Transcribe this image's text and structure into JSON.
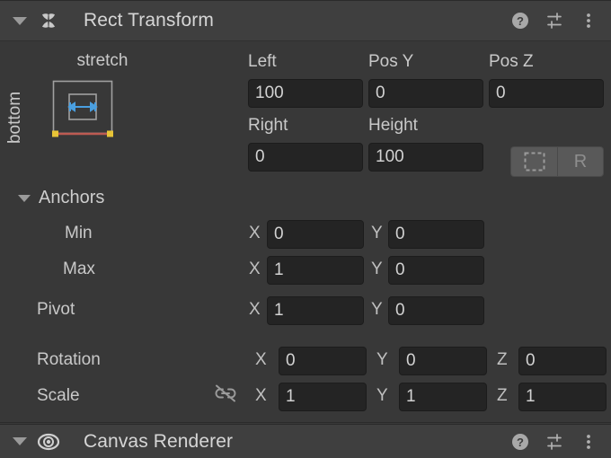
{
  "components": [
    {
      "title": "Rect Transform",
      "icon": "rect-transform-icon",
      "expanded": true,
      "actions": [
        {
          "name": "help-icon",
          "label": "?"
        },
        {
          "name": "preset-icon",
          "label": ""
        },
        {
          "name": "more-menu-icon",
          "label": ""
        }
      ]
    },
    {
      "title": "Canvas Renderer",
      "icon": "canvas-renderer-eye-icon",
      "expanded": true,
      "actions": [
        {
          "name": "help-icon",
          "label": "?"
        },
        {
          "name": "preset-icon",
          "label": ""
        },
        {
          "name": "more-menu-icon",
          "label": ""
        }
      ]
    }
  ],
  "anchor_preset": {
    "horizontal_label": "stretch",
    "vertical_label": "bottom",
    "outer_color": "#a0a0a0",
    "inner_color": "#a0a0a0",
    "arrow_color": "#4a9fe0",
    "anchor_line_color": "#bd5b52",
    "handle_color": "#e8c437"
  },
  "rect_fields": {
    "left": {
      "label": "Left",
      "value": "100"
    },
    "pos_y": {
      "label": "Pos Y",
      "value": "0"
    },
    "pos_z": {
      "label": "Pos Z",
      "value": "0"
    },
    "right": {
      "label": "Right",
      "value": "0"
    },
    "height": {
      "label": "Height",
      "value": "100"
    }
  },
  "mode_toggles": {
    "blueprint": {
      "label": "",
      "name": "blueprint-mode-toggle",
      "active": false
    },
    "raw": {
      "label": "R",
      "name": "raw-mode-toggle",
      "active": false
    }
  },
  "anchors": {
    "section_label": "Anchors",
    "rows": [
      {
        "label": "Min",
        "x_label": "X",
        "x": "0",
        "y_label": "Y",
        "y": "0"
      },
      {
        "label": "Max",
        "x_label": "X",
        "x": "1",
        "y_label": "Y",
        "y": "0"
      }
    ]
  },
  "pivot": {
    "label": "Pivot",
    "x_label": "X",
    "x": "1",
    "y_label": "Y",
    "y": "0"
  },
  "rotation": {
    "label": "Rotation",
    "x_label": "X",
    "x": "0",
    "y_label": "Y",
    "y": "0",
    "z_label": "Z",
    "z": "0"
  },
  "scale": {
    "label": "Scale",
    "link_icon": "link-off-icon",
    "x_label": "X",
    "x": "1",
    "y_label": "Y",
    "y": "1",
    "z_label": "Z",
    "z": "1"
  },
  "colors": {
    "panel_bg": "#383838",
    "header_bg": "#3f3f3f",
    "field_bg": "#242424",
    "text": "#c9c9c9",
    "accent_blue": "#4a9fe0",
    "anchor_red": "#bd5b52",
    "handle_yellow": "#e8c437"
  }
}
